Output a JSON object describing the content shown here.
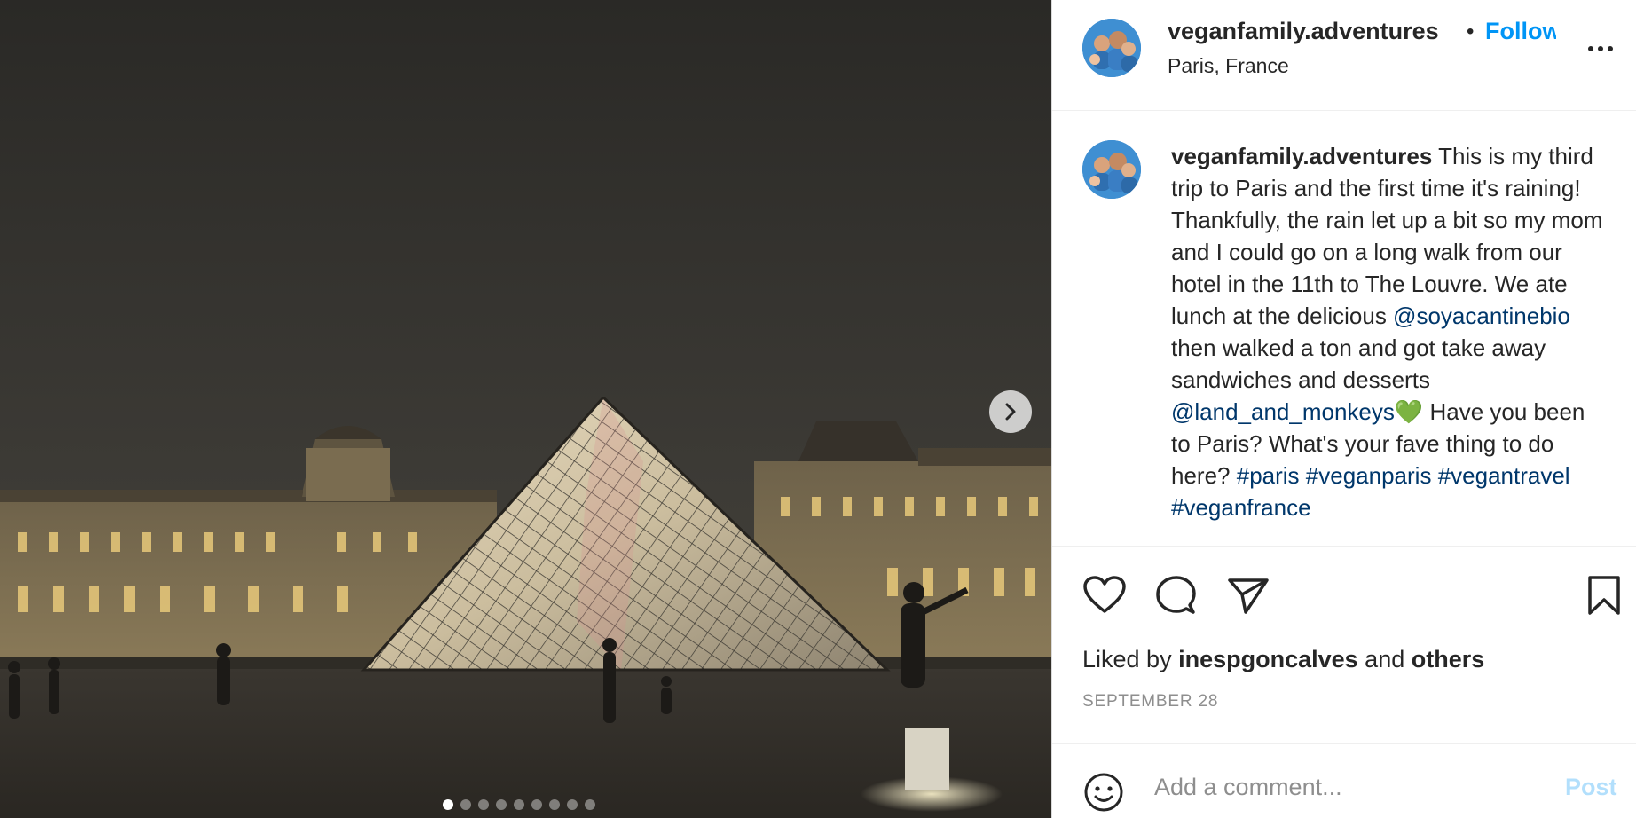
{
  "post": {
    "username": "veganfamily.adventures",
    "follow_label": "Follow",
    "separator": "•",
    "location": "Paris, France",
    "more_icon": "more-horizontal-icon"
  },
  "photo": {
    "next_icon": "chevron-right-icon",
    "slide_count": 9,
    "active_slide": 1
  },
  "caption": {
    "username": "veganfamily.adventures",
    "part1": " This is my third trip to Paris and the first time it's raining! Thankfully, the rain let up a bit so my mom and I could go on a long walk from our hotel in the 11th to The Louvre. We ate lunch at the delicious ",
    "mention1": "@soyacantinebio",
    "part2": " then walked a ton and got take away sandwiches and desserts ",
    "mention2": "@land_and_monkeys",
    "emoji": "💚",
    "part3": " Have you been to Paris? What's your fave thing to do here? ",
    "tag1": "#paris",
    "space": " ",
    "tag2": "#veganparis",
    "tag3": "#vegantravel",
    "tag4": "#veganfrance"
  },
  "actions": {
    "like_icon": "heart-icon",
    "comment_icon": "comment-icon",
    "share_icon": "send-icon",
    "save_icon": "bookmark-icon"
  },
  "likes": {
    "prefix": "Liked by ",
    "user": "inespgoncalves",
    "middle": " and ",
    "others": "others"
  },
  "date": "SEPTEMBER 28",
  "comment": {
    "placeholder": "Add a comment...",
    "post_label": "Post",
    "emoji_icon": "smiley-icon"
  },
  "colors": {
    "link_blue": "#0095f6",
    "mention_blue": "#00376b",
    "post_disabled": "#b2dffc",
    "muted_text": "#8e8e8e"
  }
}
